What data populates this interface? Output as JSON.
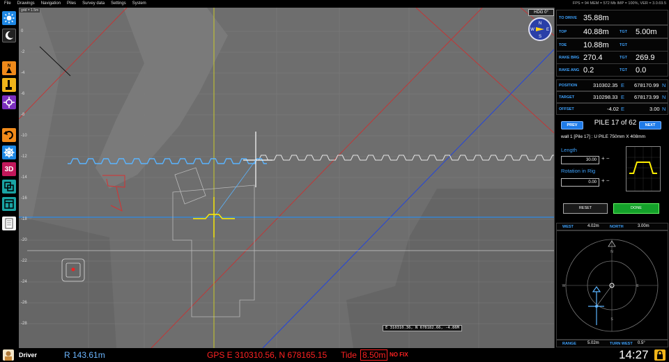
{
  "menu": [
    "File",
    "Drawings",
    "Navigation",
    "Piles",
    "Survey data",
    "Settings",
    "System"
  ],
  "stats": "FPS = 94  MEM = 572 Mb  IMP = 100%,  VER = 3.0.69.5",
  "map": {
    "grid_tag": "grid = 1.5m",
    "y_labels": [
      "0",
      "-2",
      "-4",
      "-6",
      "-8",
      "-10",
      "-12",
      "-14",
      "-16",
      "-18",
      "-20",
      "-22",
      "-24",
      "-26",
      "-28"
    ],
    "hdg": "HDG 0°",
    "compass_letters": [
      "N",
      "E",
      "S",
      "W"
    ],
    "coord_readout": "E 310310.36,  N 678182.66,  -4.86M"
  },
  "panel": {
    "to_drive": {
      "label": "TO DRIVE",
      "value": "35.88m"
    },
    "top": {
      "label": "TOP",
      "value": "40.88m",
      "tgt_label": "TGT",
      "tgt_value": "5.00m"
    },
    "toe": {
      "label": "TOE",
      "value": "10.88m",
      "tgt_label": "TGT",
      "tgt_value": ""
    },
    "rake_brg": {
      "label": "RAKE BRG",
      "value": "270.4",
      "tgt_label": "TGT",
      "tgt_value": "269.9"
    },
    "rake_ang": {
      "label": "RAKE ANG",
      "value": "0.2",
      "tgt_label": "TGT",
      "tgt_value": "0.0"
    },
    "position": {
      "label": "POSITION",
      "e": "310302.35",
      "e_unit": "E",
      "n": "678170.99",
      "n_unit": "N"
    },
    "target": {
      "label": "TARGET",
      "e": "310298.33",
      "e_unit": "E",
      "n": "678173.99",
      "n_unit": "N"
    },
    "offset": {
      "label": "OFFSET",
      "e": "-4.02",
      "e_unit": "E",
      "n": "3.00",
      "n_unit": "N"
    },
    "prev": "PREV",
    "pile_title": "PILE 17 of 62",
    "next": "NEXT",
    "pile_desc": "wall 1 [Pile 17] : U PILE 750mm X 408mm",
    "length_label": "Length",
    "length_value": "30.00",
    "rotation_label": "Rotation in Rig",
    "rotation_value": "0.00",
    "reset": "RESET",
    "done": "DONE",
    "west_label": "WEST",
    "west_value": "4.02m",
    "north_label": "NORTH",
    "north_value": "3.00m",
    "range_label": "RANGE",
    "range_value": "5.02m",
    "turn_label": "TURN WEST",
    "turn_value": "0.5°",
    "scope_letters": [
      "N",
      "E",
      "S",
      "W"
    ]
  },
  "status": {
    "driver": "Driver",
    "radius": "R 143.61m",
    "gps": "GPS  E 310310.56, N 678165.15",
    "tide_label": "Tide",
    "tide_value": "8.50m",
    "fix": "NO FIX",
    "clock": "14:27"
  },
  "colors": {
    "accent": "#3ea3ff",
    "done": "#14a12a",
    "gps": "#ff2222",
    "pile_outline": "#ffee00",
    "sheet_pile": "#5ab4ff"
  }
}
